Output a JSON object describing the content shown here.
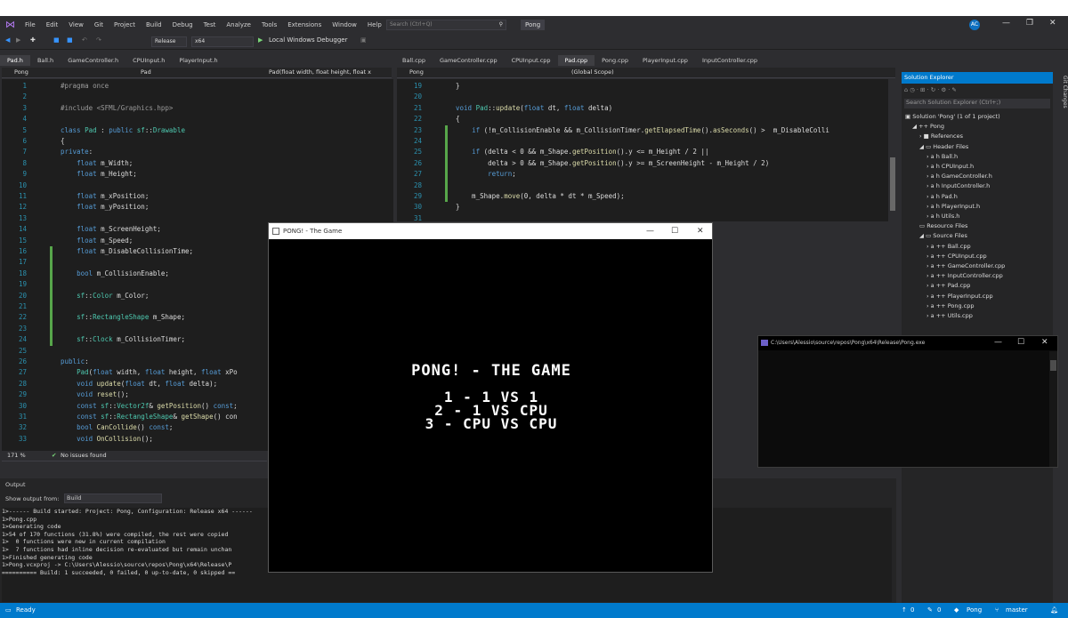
{
  "menu": [
    "File",
    "Edit",
    "View",
    "Git",
    "Project",
    "Build",
    "Debug",
    "Test",
    "Analyze",
    "Tools",
    "Extensions",
    "Window",
    "Help"
  ],
  "search_placeholder": "Search (Ctrl+Q)",
  "solution_name": "Pong",
  "user_initials": "AC",
  "toolbar": {
    "config": "Release",
    "platform": "x64",
    "run": "Local Windows Debugger"
  },
  "left_editor": {
    "tabs": [
      "Pad.h",
      "Ball.h",
      "GameController.h",
      "CPUInput.h",
      "PlayerInput.h"
    ],
    "active_tab": "Pad.h",
    "nav_project": "Pong",
    "nav_class": "Pad",
    "nav_member": "Pad(float width, float height, float x",
    "zoom": "171 %",
    "issues": "No issues found",
    "lines": [
      {
        "n": "1",
        "t": "#pragma once"
      },
      {
        "n": "2",
        "t": ""
      },
      {
        "n": "3",
        "t": "#include <SFML/Graphics.hpp>"
      },
      {
        "n": "4",
        "t": ""
      },
      {
        "n": "5",
        "t": "class Pad : public sf::Drawable"
      },
      {
        "n": "6",
        "t": "{"
      },
      {
        "n": "7",
        "t": "private:"
      },
      {
        "n": "8",
        "t": "    float m_Width;"
      },
      {
        "n": "9",
        "t": "    float m_Height;"
      },
      {
        "n": "10",
        "t": ""
      },
      {
        "n": "11",
        "t": "    float m_xPosition;"
      },
      {
        "n": "12",
        "t": "    float m_yPosition;"
      },
      {
        "n": "13",
        "t": ""
      },
      {
        "n": "14",
        "t": "    float m_ScreenHeight;"
      },
      {
        "n": "15",
        "t": "    float m_Speed;"
      },
      {
        "n": "16",
        "t": "    float m_DisableCollisionTime;"
      },
      {
        "n": "17",
        "t": ""
      },
      {
        "n": "18",
        "t": "    bool m_CollisionEnable;"
      },
      {
        "n": "19",
        "t": ""
      },
      {
        "n": "20",
        "t": "    sf::Color m_Color;"
      },
      {
        "n": "21",
        "t": ""
      },
      {
        "n": "22",
        "t": "    sf::RectangleShape m_Shape;"
      },
      {
        "n": "23",
        "t": ""
      },
      {
        "n": "24",
        "t": "    sf::Clock m_CollisionTimer;"
      },
      {
        "n": "25",
        "t": ""
      },
      {
        "n": "26",
        "t": "public:"
      },
      {
        "n": "27",
        "t": "    Pad(float width, float height, float xPo"
      },
      {
        "n": "28",
        "t": "    void update(float dt, float delta);"
      },
      {
        "n": "29",
        "t": "    void reset();"
      },
      {
        "n": "30",
        "t": "    const sf::Vector2f& getPosition() const;"
      },
      {
        "n": "31",
        "t": "    const sf::RectangleShape& getShape() con"
      },
      {
        "n": "32",
        "t": "    bool CanCollide() const;"
      },
      {
        "n": "33",
        "t": "    void OnCollision();"
      }
    ]
  },
  "right_editor": {
    "tabs": [
      "Ball.cpp",
      "GameController.cpp",
      "CPUInput.cpp",
      "Pad.cpp",
      "Pong.cpp",
      "PlayerInput.cpp",
      "InputController.cpp"
    ],
    "active_tab": "Pad.cpp",
    "nav_project": "Pong",
    "nav_scope": "(Global Scope)",
    "lines": [
      {
        "n": "19",
        "t": "}"
      },
      {
        "n": "20",
        "t": ""
      },
      {
        "n": "21",
        "t": "void Pad::update(float dt, float delta)"
      },
      {
        "n": "22",
        "t": "{"
      },
      {
        "n": "23",
        "t": "    if (!m_CollisionEnable && m_CollisionTimer.getElapsedTime().asSeconds() >  m_DisableColli"
      },
      {
        "n": "24",
        "t": ""
      },
      {
        "n": "25",
        "t": "    if (delta < 0 && m_Shape.getPosition().y <= m_Height / 2 ||"
      },
      {
        "n": "26",
        "t": "        delta > 0 && m_Shape.getPosition().y >= m_ScreenHeight - m_Height / 2)"
      },
      {
        "n": "27",
        "t": "        return;"
      },
      {
        "n": "28",
        "t": ""
      },
      {
        "n": "29",
        "t": "    m_Shape.move(0, delta * dt * m_Speed);"
      },
      {
        "n": "30",
        "t": "}"
      },
      {
        "n": "31",
        "t": ""
      }
    ]
  },
  "game_window": {
    "title": "PONG! - The Game",
    "heading": "PONG! - THE GAME",
    "options": [
      "1 - 1 VS 1",
      "2 - 1 VS CPU",
      "3 - CPU VS CPU"
    ]
  },
  "console_window": {
    "title": "C:\\Users\\Alessio\\source\\repos\\Pong\\x64\\Release\\Pong.exe"
  },
  "solution_explorer": {
    "title": "Solution Explorer",
    "search": "Search Solution Explorer (Ctrl+;)",
    "solution": "Solution 'Pong' (1 of 1 project)",
    "project": "Pong",
    "references": "References",
    "header_files": "Header Files",
    "headers": [
      "Ball.h",
      "CPUInput.h",
      "GameController.h",
      "InputController.h",
      "Pad.h",
      "PlayerInput.h",
      "Utils.h"
    ],
    "resource_files": "Resource Files",
    "source_files": "Source Files",
    "sources": [
      "Ball.cpp",
      "CPUInput.cpp",
      "GameController.cpp",
      "InputController.cpp",
      "Pad.cpp",
      "PlayerInput.cpp",
      "Pong.cpp",
      "Utils.cpp"
    ]
  },
  "output": {
    "title": "Output",
    "show_from_label": "Show output from:",
    "show_from": "Build",
    "lines": [
      "1>------ Build started: Project: Pong, Configuration: Release x64 ------",
      "1>Pong.cpp",
      "1>Generating code",
      "1>54 of 170 functions (31.8%) were compiled, the rest were copied",
      "1>  0 functions were new in current compilation",
      "1>  7 functions had inline decision re-evaluated but remain unchan",
      "1>Finished generating code",
      "1>Pong.vcxproj -> C:\\Users\\Alessio\\source\\repos\\Pong\\x64\\Release\\P",
      "========== Build: 1 succeeded, 0 failed, 0 up-to-date, 0 skipped =="
    ]
  },
  "status": {
    "ready": "Ready",
    "up": "0",
    "pencil": "0",
    "repo": "Pong",
    "branch": "master"
  },
  "colors": {
    "accent": "#007acc",
    "editor_bg": "#1e1e1e",
    "chrome_bg": "#2d2d30"
  }
}
